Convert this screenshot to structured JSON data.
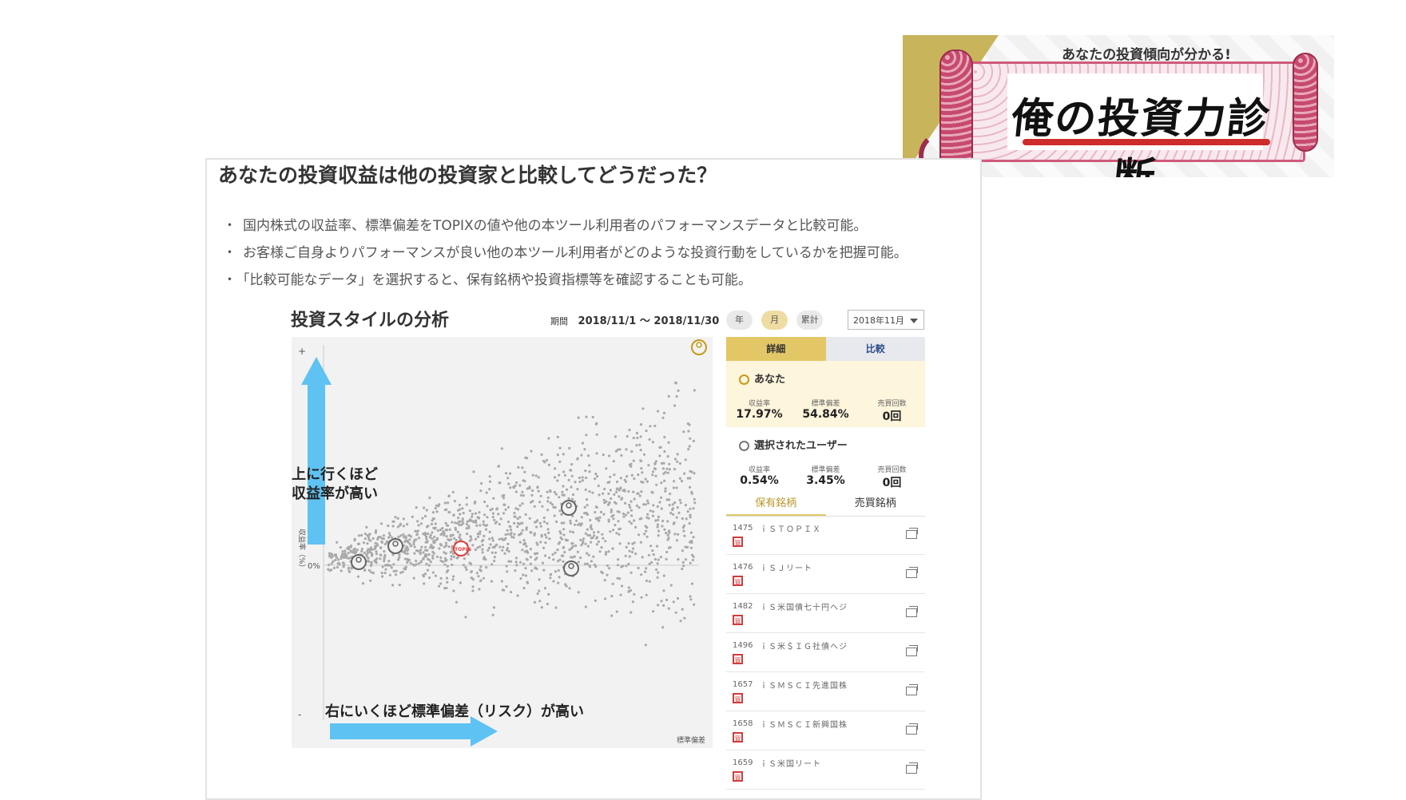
{
  "banner": {
    "subtitle": "あなたの投資傾向が分かる!",
    "title": "俺の投資力診断"
  },
  "heading": "あなたの投資収益は他の投資家と比較してどうだった？",
  "bullets": [
    "国内株式の収益率、標準偏差をTOPIXの値や他の本ツール利用者のパフォーマンスデータと比較可能。",
    "お客様ご自身よりパフォーマンスが良い他の本ツール利用者がどのような投資行動をしているかを把握可能。",
    "「比較可能なデータ」を選択すると、保有銘柄や投資指標等を確認することも可能。"
  ],
  "analysis": {
    "title": "投資スタイルの分析",
    "period_label": "期間",
    "period": "2018/11/1 ～ 2018/11/30"
  },
  "chart_data": {
    "type": "scatter",
    "ylabel": "収益率（%）",
    "xlabel": "標準偏差",
    "y_plus_label": "+",
    "y_minus_label": "-",
    "y_zero_label": "0%",
    "annotation_up": "上に行くほど\n収益率が高い",
    "annotation_right": "右にいくほど標準偏差（リスク）が高い",
    "topix_label": "TOPIX",
    "colors": {
      "points": "#a9a9a9",
      "arrow": "#5ec2f2",
      "topix": "#e23b3b",
      "you": "#c59a1c"
    }
  },
  "controls": {
    "periods": [
      {
        "label": "年",
        "active": false
      },
      {
        "label": "月",
        "active": true
      },
      {
        "label": "累計",
        "active": false
      }
    ],
    "month_select": "2018年11月",
    "tabs": [
      "詳細",
      "比較"
    ]
  },
  "you": {
    "name": "あなた",
    "stats": [
      {
        "label": "収益率",
        "value": "17.97%"
      },
      {
        "label": "標準偏差",
        "value": "54.84%"
      },
      {
        "label": "売買回数",
        "value": "0回"
      }
    ]
  },
  "selected_user": {
    "name": "選択されたユーザー",
    "stats": [
      {
        "label": "収益率",
        "value": "0.54%"
      },
      {
        "label": "標準偏差",
        "value": "3.45%"
      },
      {
        "label": "売買回数",
        "value": "0回"
      }
    ]
  },
  "holding_tabs": [
    "保有銘柄",
    "売買銘柄"
  ],
  "holdings": [
    {
      "code": "1475",
      "name": "ｉＳＴＯＰＩＸ",
      "badge": "買"
    },
    {
      "code": "1476",
      "name": "ｉＳＪリート",
      "badge": "買"
    },
    {
      "code": "1482",
      "name": "ｉＳ米国債七十円ヘジ",
      "badge": "買"
    },
    {
      "code": "1496",
      "name": "ｉＳ米＄ＩＧ社債ヘジ",
      "badge": "買"
    },
    {
      "code": "1657",
      "name": "ｉＳＭＳＣＩ先進国株",
      "badge": "買"
    },
    {
      "code": "1658",
      "name": "ｉＳＭＳＣＩ新興国株",
      "badge": "買"
    },
    {
      "code": "1659",
      "name": "ｉＳ米国リート",
      "badge": "買"
    }
  ]
}
